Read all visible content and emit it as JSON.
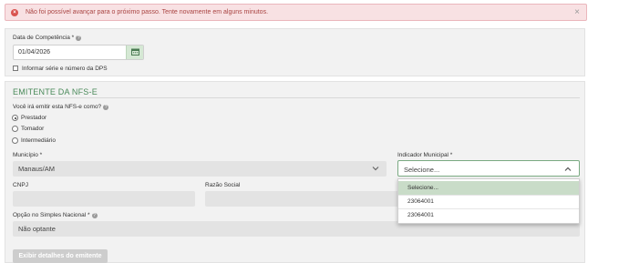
{
  "alert": {
    "message": "Não foi possível avançar para o próximo passo. Tente novamente em alguns minutos.",
    "close_glyph": "×",
    "icon": "error-circle-icon"
  },
  "competencia": {
    "label": "Data de Competência *",
    "value": "01/04/2026",
    "checkbox_label": "Informar série e número da DPS"
  },
  "emitente": {
    "title": "EMITENTE DA NFS-E",
    "question": "Você irá emitir esta NFS-e como?",
    "options": [
      "Prestador",
      "Tomador",
      "Intermediário"
    ],
    "selected_option": "Prestador"
  },
  "municipio": {
    "label": "Município *",
    "value": "Manaus/AM"
  },
  "indicador": {
    "label": "Indicador Municipal *",
    "value": "Selecione...",
    "options": [
      "Selecione...",
      "23064001",
      "23064001"
    ]
  },
  "cnpj": {
    "label": "CNPJ"
  },
  "razao": {
    "label": "Razão Social"
  },
  "simples": {
    "label": "Opção no Simples Nacional *",
    "value": "Não optante"
  },
  "button": {
    "label": "Exibir detalhes do emitente"
  },
  "colors": {
    "alert_bg": "#f8e1e3",
    "alert_text": "#a94442",
    "accent_green": "#4a8a5a",
    "selected_option_bg": "#c9dcc8"
  }
}
